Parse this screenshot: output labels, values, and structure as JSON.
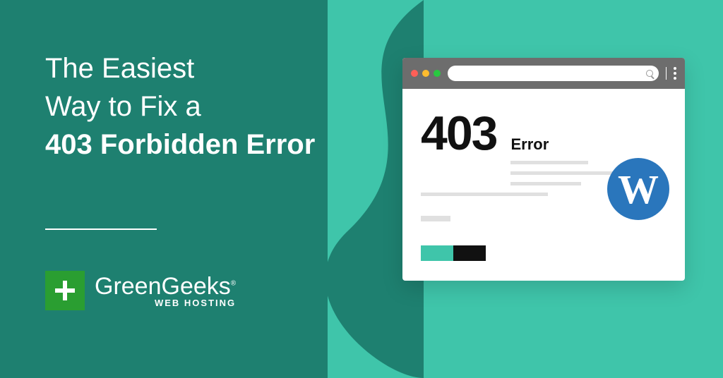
{
  "headline": {
    "line1": "The Easiest",
    "line2": "Way to Fix a",
    "line3": "403 Forbidden Error"
  },
  "logo": {
    "brand": "GreenGeeks",
    "reg": "®",
    "tagline": "WEB HOSTING"
  },
  "browser": {
    "error_code": "403",
    "error_label": "Error",
    "wp_glyph": "W"
  },
  "colors": {
    "dark_teal": "#1e8070",
    "light_teal": "#3fc5aa",
    "logo_green": "#2a9e31",
    "wp_blue": "#2a76bc"
  }
}
